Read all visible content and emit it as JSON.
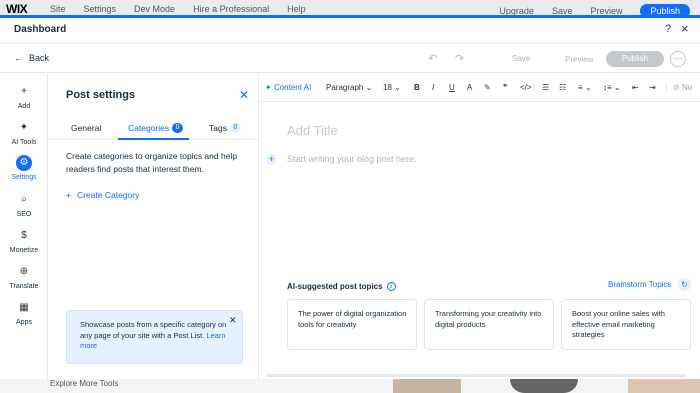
{
  "editor_bar": {
    "logo": "WIX",
    "menu": [
      "Site",
      "Settings",
      "Dev Mode",
      "Hire a Professional",
      "Help"
    ],
    "right": [
      "Upgrade",
      "Save",
      "Preview"
    ],
    "publish": "Publish"
  },
  "dashboard": {
    "title": "Dashboard",
    "help": "?",
    "close": "×"
  },
  "actions": {
    "back": "Back",
    "save": "Save",
    "preview": "Preview",
    "publish": "Publish",
    "more": "···"
  },
  "rail": [
    {
      "label": "Add",
      "icon": "plus-icon",
      "glyph": "+"
    },
    {
      "label": "AI Tools",
      "icon": "sparkle-icon",
      "glyph": "✦"
    },
    {
      "label": "Settings",
      "icon": "gear-icon",
      "glyph": "⚙"
    },
    {
      "label": "SEO",
      "icon": "search-icon",
      "glyph": "⌕"
    },
    {
      "label": "Monetize",
      "icon": "dollar-icon",
      "glyph": "$"
    },
    {
      "label": "Translate",
      "icon": "globe-icon",
      "glyph": "⊕"
    },
    {
      "label": "Apps",
      "icon": "apps-icon",
      "glyph": "▦"
    }
  ],
  "panel": {
    "title": "Post settings",
    "tabs": [
      {
        "label": "General"
      },
      {
        "label": "Categories",
        "count": "0"
      },
      {
        "label": "Tags",
        "count": "0"
      }
    ],
    "description": "Create categories to organize topics and help readers find posts that interest them.",
    "create": "Create Category",
    "info": {
      "text": "Showcase posts from a specific category on any page of your site with a Post List.",
      "link": "Learn more"
    }
  },
  "toolbar": {
    "ai": "Content AI",
    "paragraph": "Paragraph",
    "size": "18",
    "no": "No"
  },
  "editor": {
    "title_placeholder": "Add Title",
    "body_placeholder": "Start writing your blog post here."
  },
  "suggestions": {
    "title": "AI-suggested post topics",
    "brainstorm": "Brainstorm Topics",
    "cards": [
      "The power of digital organization tools for creativity",
      "Transforming your creativity into digital products",
      "Boost your online sales with effective email marketing strategies"
    ]
  },
  "background": {
    "explore": "Explore More Tools"
  },
  "colors": {
    "accent": "#116dff",
    "text": "#162d3d",
    "disabled": "#c5c9ce"
  }
}
